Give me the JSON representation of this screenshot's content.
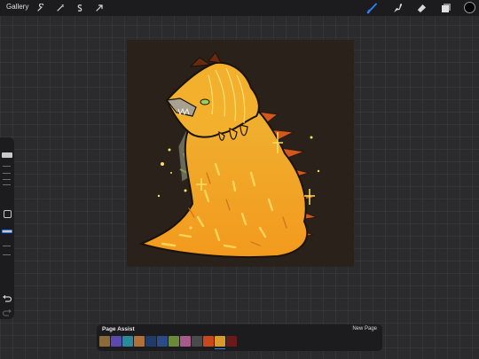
{
  "topbar": {
    "gallery_label": "Gallery",
    "left_tools": [
      "wrench-icon",
      "magic-wand-icon",
      "selection-icon",
      "transform-arrow-icon"
    ],
    "right_tools": [
      "brush-icon",
      "smudge-icon",
      "eraser-icon",
      "layers-icon"
    ],
    "active_tool": "brush-icon",
    "current_color": "#050505"
  },
  "sidebar": {
    "controls": [
      "brush-size-slider",
      "modify-button",
      "opacity-slider",
      "undo-button",
      "redo-button"
    ]
  },
  "canvas": {
    "background": "#2a211b",
    "artwork": "golden dragon illustration"
  },
  "page_assist": {
    "title": "Page Assist",
    "new_page_label": "New Page",
    "pages": [
      {
        "color": "#8a6a3a"
      },
      {
        "color": "#5a4ab0"
      },
      {
        "color": "#2a8a9a"
      },
      {
        "color": "#b0703a"
      },
      {
        "color": "#203a6a"
      },
      {
        "color": "#2a4a8a"
      },
      {
        "color": "#6a8a3a"
      },
      {
        "color": "#a85a8a"
      },
      {
        "color": "#4a4a4a"
      },
      {
        "color": "#c8481a"
      },
      {
        "color": "#d89a2a",
        "selected": true
      },
      {
        "color": "#6a1a1a"
      }
    ]
  }
}
